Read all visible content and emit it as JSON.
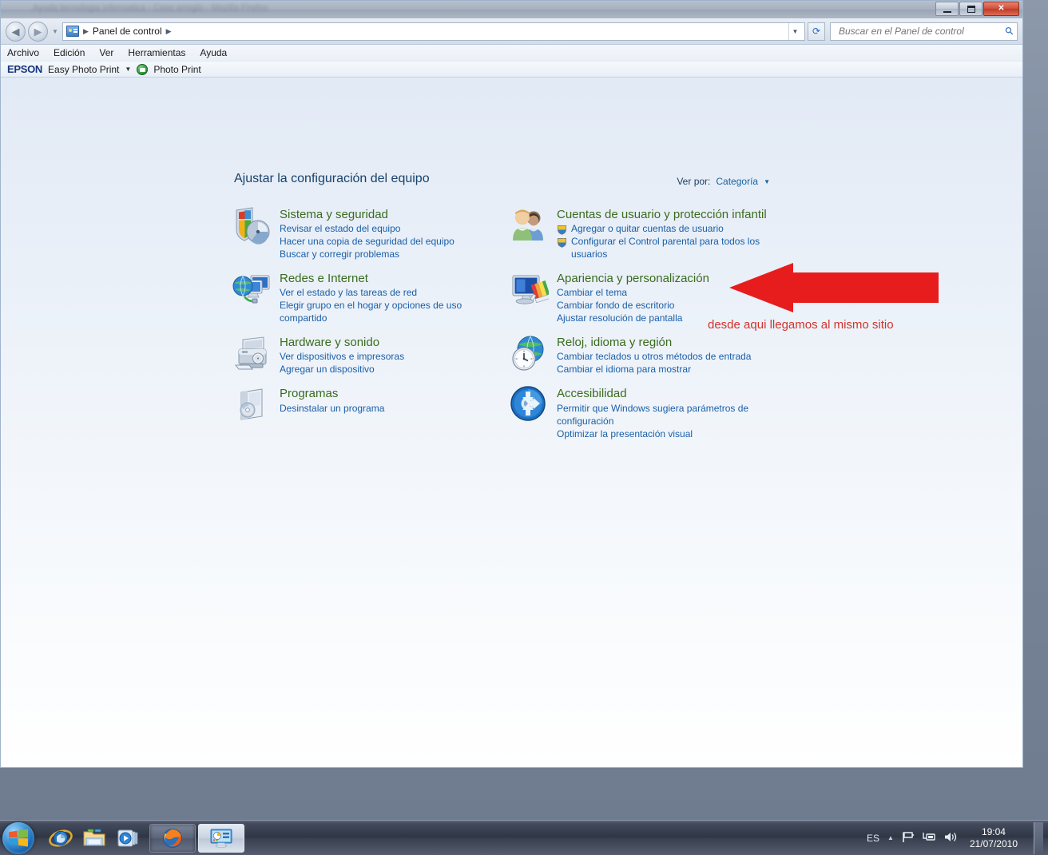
{
  "window": {
    "title_ghost": "Ayuda   tecnologia informatica - Caso arreglo - Mozilla Firefox",
    "buttons": {
      "minimize": "minimizar",
      "maximize": "maximizar",
      "close": "Cerrar"
    }
  },
  "navbar": {
    "back": "Atrás",
    "forward": "Adelante",
    "history_dropdown": "Páginas recientes",
    "breadcrumb": [
      "Panel de control"
    ],
    "refresh": "Actualizar",
    "search_placeholder": "Buscar en el Panel de control",
    "search_value": ""
  },
  "menubar": {
    "items": [
      "Archivo",
      "Edición",
      "Ver",
      "Herramientas",
      "Ayuda"
    ]
  },
  "epson_toolbar": {
    "logo": "EPSON",
    "easy_photo_print": "Easy Photo Print",
    "photo_print": "Photo Print"
  },
  "content": {
    "heading": "Ajustar la configuración del equipo",
    "view_by_label": "Ver por:",
    "view_by_value": "Categoría"
  },
  "categories_left": [
    {
      "icon": "security-shield-icon",
      "title": "Sistema y seguridad",
      "links": [
        {
          "text": "Revisar el estado del equipo",
          "shield": false
        },
        {
          "text": "Hacer una copia de seguridad del equipo",
          "shield": false
        },
        {
          "text": "Buscar y corregir problemas",
          "shield": false
        }
      ]
    },
    {
      "icon": "network-globe-icon",
      "title": "Redes e Internet",
      "links": [
        {
          "text": "Ver el estado y las tareas de red",
          "shield": false
        },
        {
          "text": "Elegir grupo en el hogar y opciones de uso compartido",
          "shield": false
        }
      ]
    },
    {
      "icon": "printer-icon",
      "title": "Hardware y sonido",
      "links": [
        {
          "text": "Ver dispositivos e impresoras",
          "shield": false
        },
        {
          "text": "Agregar un dispositivo",
          "shield": false
        }
      ]
    },
    {
      "icon": "programs-box-icon",
      "title": "Programas",
      "links": [
        {
          "text": "Desinstalar un programa",
          "shield": false
        }
      ]
    }
  ],
  "categories_right": [
    {
      "icon": "users-icon",
      "title": "Cuentas de usuario y protección infantil",
      "links": [
        {
          "text": "Agregar o quitar cuentas de usuario",
          "shield": true
        },
        {
          "text": "Configurar el Control parental para todos los usuarios",
          "shield": true
        }
      ]
    },
    {
      "icon": "display-palette-icon",
      "title": "Apariencia y personalización",
      "links": [
        {
          "text": "Cambiar el tema",
          "shield": false
        },
        {
          "text": "Cambiar fondo de escritorio",
          "shield": false
        },
        {
          "text": "Ajustar resolución de pantalla",
          "shield": false
        }
      ]
    },
    {
      "icon": "clock-globe-icon",
      "title": "Reloj, idioma y región",
      "links": [
        {
          "text": "Cambiar teclados u otros métodos de entrada",
          "shield": false
        },
        {
          "text": "Cambiar el idioma para mostrar",
          "shield": false
        }
      ]
    },
    {
      "icon": "accessibility-icon",
      "title": "Accesibilidad",
      "links": [
        {
          "text": "Permitir que Windows sugiera parámetros de configuración",
          "shield": false
        },
        {
          "text": "Optimizar la presentación visual",
          "shield": false
        }
      ]
    }
  ],
  "annotation": {
    "arrow": "red-left-arrow",
    "text": "desde aqui llegamos al mismo sitio",
    "color": "#d0342c"
  },
  "taskbar": {
    "start": "Inicio",
    "quicklaunch": [
      {
        "name": "internet-explorer-icon",
        "label": "Internet Explorer"
      },
      {
        "name": "windows-explorer-icon",
        "label": "Explorador de Windows"
      },
      {
        "name": "media-player-icon",
        "label": "Reproductor de Windows Media"
      }
    ],
    "windows": [
      {
        "name": "firefox-taskbar-button",
        "label": "Mozilla Firefox",
        "state": "pressed"
      },
      {
        "name": "control-panel-taskbar-button",
        "label": "Panel de control",
        "state": "active"
      }
    ],
    "tray": {
      "language": "ES",
      "show_hidden": "Mostrar iconos ocultos",
      "icons": [
        "flag-action-center-icon",
        "network-icon",
        "volume-icon"
      ],
      "time": "19:04",
      "date": "21/07/2010"
    }
  },
  "colors": {
    "category_title": "#3a6b1e",
    "link": "#1a5fa8",
    "heading": "#17426b",
    "annotation": "#d0342c",
    "accent": "#2b6bbf"
  }
}
